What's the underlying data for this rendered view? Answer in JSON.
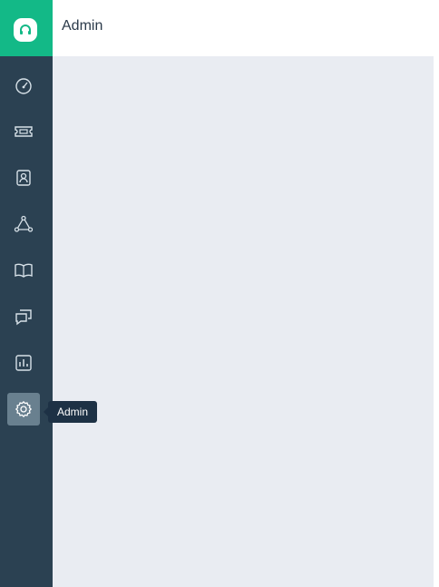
{
  "header": {
    "title": "Admin"
  },
  "sidebar": {
    "logo_icon": "headset-icon",
    "items": [
      {
        "icon": "dashboard-icon"
      },
      {
        "icon": "ticket-icon"
      },
      {
        "icon": "contact-icon"
      },
      {
        "icon": "network-icon"
      },
      {
        "icon": "book-icon"
      },
      {
        "icon": "chat-icon"
      },
      {
        "icon": "report-icon"
      },
      {
        "icon": "gear-icon",
        "active": true
      }
    ]
  },
  "tooltip": {
    "label": "Admin"
  },
  "colors": {
    "sidebar": "#2b4152",
    "brand": "#13b987",
    "active_item": "#69808f",
    "content_bg": "#e9ecf2",
    "tooltip_bg": "#1d3145"
  }
}
